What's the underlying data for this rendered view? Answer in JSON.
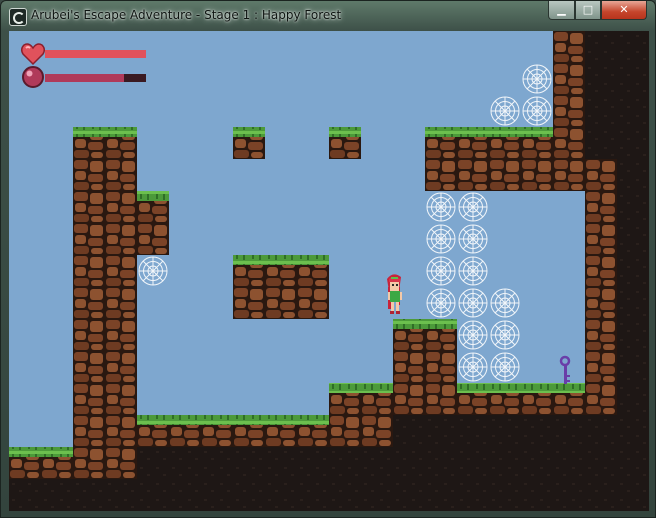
{
  "window": {
    "title": "Arubei's Escape Adventure - Stage 1 : Happy Forest",
    "minimize_glyph": "▁",
    "maximize_glyph": "□",
    "close_glyph": "✕"
  },
  "hud": {
    "health_fraction": 1.0,
    "magic_fraction": 0.78,
    "health_icon": "heart-icon",
    "magic_icon": "orb-icon"
  },
  "colors": {
    "sky": "#7ea7cf",
    "dirt": "#7b4327",
    "dirt_dark": "#2a1810",
    "grass": "#4c9a3a",
    "cave": "#1e1715",
    "health": "#e0525c",
    "magic": "#b03a5a"
  },
  "scene": {
    "character": "player-character",
    "item": "purple-key"
  }
}
